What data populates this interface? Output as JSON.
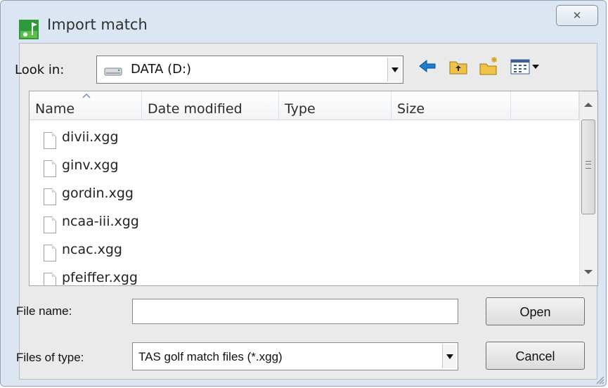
{
  "window": {
    "title": "Import match",
    "close_glyph": "✕",
    "app_icon": "golf-flag-icon"
  },
  "look_in": {
    "label": "Look in:",
    "value": "DATA (D:)",
    "icon": "drive-icon"
  },
  "toolbar": {
    "icons": [
      "back-arrow-icon",
      "up-folder-icon",
      "new-folder-icon",
      "view-menu-icon"
    ]
  },
  "file_list": {
    "columns": [
      "Name",
      "Date modified",
      "Type",
      "Size"
    ],
    "sort_column": "Name",
    "files": [
      "divii.xgg",
      "ginv.xgg",
      "gordin.xgg",
      "ncaa-iii.xgg",
      "ncac.xgg",
      "pfeiffer.xgg"
    ]
  },
  "file_name": {
    "label": "File name:",
    "value": "",
    "placeholder": ""
  },
  "file_type": {
    "label": "Files of type:",
    "value": "TAS golf match files (*.xgg)"
  },
  "buttons": {
    "open": "Open",
    "cancel": "Cancel"
  },
  "colors": {
    "window_frame": "#dce6f2",
    "client_background": "#eaeaea",
    "back_arrow": "#1a7fd0",
    "folder": "#d9a21a",
    "app_icon_green": "#2f9a3a"
  }
}
